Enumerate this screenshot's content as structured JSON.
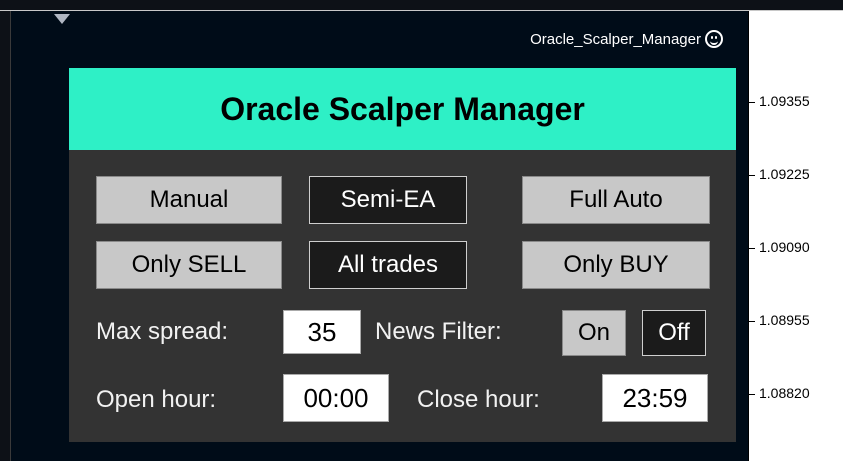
{
  "chart": {
    "ea_name": "Oracle_Scalper_Manager",
    "ea_status_icon": "smiley-icon",
    "price_scale": [
      "1.09355",
      "1.09225",
      "1.09090",
      "1.08955",
      "1.08820"
    ]
  },
  "panel": {
    "title": "Oracle Scalper Manager",
    "header_color": "#2ef0c6",
    "mode_buttons": [
      {
        "label": "Manual",
        "active": false
      },
      {
        "label": "Semi-EA",
        "active": true
      },
      {
        "label": "Full Auto",
        "active": false
      }
    ],
    "direction_buttons": [
      {
        "label": "Only SELL",
        "active": false
      },
      {
        "label": "All trades",
        "active": true
      },
      {
        "label": "Only BUY",
        "active": false
      }
    ],
    "max_spread": {
      "label": "Max spread:",
      "value": "35"
    },
    "news_filter": {
      "label": "News Filter:",
      "on_label": "On",
      "off_label": "Off",
      "selected": "Off"
    },
    "open_hour": {
      "label": "Open hour:",
      "value": "00:00"
    },
    "close_hour": {
      "label": "Close hour:",
      "value": "23:59"
    }
  }
}
